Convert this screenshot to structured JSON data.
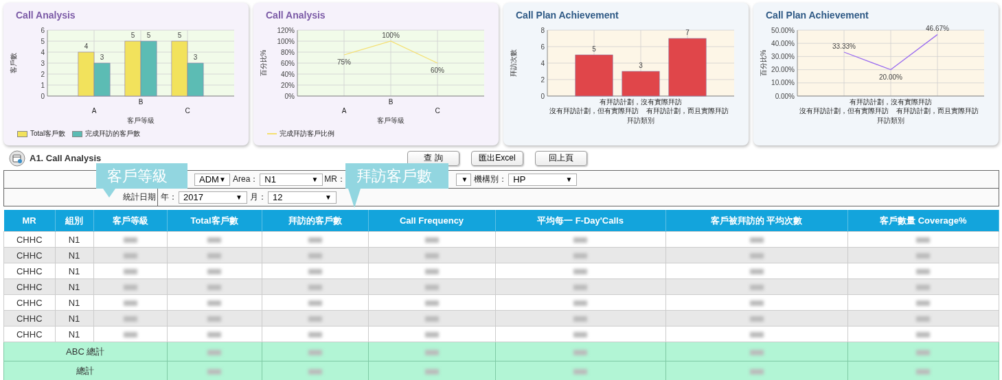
{
  "cards": [
    {
      "title": "Call Analysis",
      "chart_data": {
        "type": "bar",
        "grid": true,
        "xlabel": "客戶等級",
        "ylabel": "客戶數",
        "categories": [
          "A",
          "B",
          "C"
        ],
        "series": [
          {
            "name": "Total客戶數",
            "color": "#f2e25c",
            "values": [
              4,
              5,
              5
            ]
          },
          {
            "name": "完成拜訪的客戶數",
            "color": "#5cbcb4",
            "values": [
              3,
              5,
              3
            ]
          }
        ],
        "ylim": [
          0,
          6
        ],
        "yticks": [
          0,
          1,
          2,
          3,
          4,
          5,
          6
        ],
        "data_labels": true
      }
    },
    {
      "title": "Call Analysis",
      "chart_data": {
        "type": "line",
        "grid": true,
        "xlabel": "客戶等級",
        "ylabel": "百分比%",
        "categories": [
          "A",
          "B",
          "C"
        ],
        "series": [
          {
            "name": "完成拜訪客戶比例",
            "color": "#f5df70",
            "values": [
              75,
              100,
              60
            ]
          }
        ],
        "ylim": [
          0,
          120
        ],
        "yticks": [
          {
            "value": 0,
            "label": "0%"
          },
          {
            "value": 20,
            "label": "20%"
          },
          {
            "value": 40,
            "label": "40%"
          },
          {
            "value": 60,
            "label": "60%"
          },
          {
            "value": 80,
            "label": "80%"
          },
          {
            "value": 100,
            "label": "100%"
          },
          {
            "value": 120,
            "label": "120%"
          }
        ],
        "value_labels": [
          "75%",
          "100%",
          "60%"
        ]
      }
    },
    {
      "title": "Call Plan Achievement",
      "chart_data": {
        "type": "bar",
        "grid": true,
        "xlabel": "拜訪類別",
        "ylabel": "拜訪次數",
        "categories": [
          "沒有拜訪計劃，但有實際拜訪",
          "有拜訪計劃，沒有實際拜訪",
          "有拜訪計劃，而且實際拜訪"
        ],
        "series": [
          {
            "color": "#e0464a",
            "values": [
              5,
              3,
              7
            ]
          }
        ],
        "ylim": [
          0,
          8
        ],
        "yticks": [
          0,
          2,
          4,
          6,
          8
        ],
        "data_labels": true
      }
    },
    {
      "title": "Call Plan Achievement",
      "chart_data": {
        "type": "line",
        "grid": true,
        "xlabel": "拜訪類別",
        "ylabel": "百分比%",
        "categories": [
          "沒有拜訪計劃，但有實際拜訪",
          "有拜訪計劃，沒有實際拜訪",
          "有拜訪計劃，而且實際拜訪"
        ],
        "series": [
          {
            "color": "#9a6cf0",
            "values": [
              33.33,
              20,
              46.67
            ]
          }
        ],
        "ylim": [
          0,
          50
        ],
        "yticks": [
          {
            "value": 0,
            "label": "0.00%"
          },
          {
            "value": 10,
            "label": "10.00%"
          },
          {
            "value": 20,
            "label": "20.00%"
          },
          {
            "value": 30,
            "label": "30.00%"
          },
          {
            "value": 40,
            "label": "40.00%"
          },
          {
            "value": 50,
            "label": "50.00%"
          }
        ],
        "value_labels": [
          "33.33%",
          "20.00%",
          "46.67%"
        ]
      }
    }
  ],
  "section": {
    "title": "A1. Call Analysis",
    "buttons": [
      "查 詢",
      "匯出Excel",
      "回上頁"
    ]
  },
  "filters": [
    [
      {
        "value": "ADM",
        "caret": "▼"
      },
      {
        "label": "Area：",
        "value": "N1",
        "caret": "▼"
      },
      {
        "label": "MR：",
        "caret": "▼"
      },
      {
        "label": "機構別：",
        "value": "HP",
        "caret": "▼"
      }
    ],
    [
      {
        "label": "統計日期"
      },
      {
        "label": "年：",
        "value": "2017",
        "caret": "▼"
      },
      {
        "label": "月：",
        "value": "12",
        "caret": "▼"
      }
    ]
  ],
  "callouts": [
    {
      "text": "客戶等級"
    },
    {
      "text": "拜訪客戶數"
    }
  ],
  "table": {
    "columns": [
      "MR",
      "組別",
      "客戶等級",
      "Total客戶數",
      "拜訪的客戶數",
      "Call Frequency",
      "平均每一 F-Day'Calls",
      "客戶被拜訪的 平均次數",
      "客戶數量 Coverage%"
    ],
    "rows": [
      {
        "cells": [
          "CHHC",
          "N1"
        ]
      },
      {
        "cells": [
          "CHHC",
          "N1"
        ]
      },
      {
        "cells": [
          "CHHC",
          "N1"
        ]
      },
      {
        "cells": [
          "CHHC",
          "N1"
        ]
      },
      {
        "cells": [
          "CHHC",
          "N1"
        ]
      },
      {
        "cells": [
          "CHHC",
          "N1"
        ]
      },
      {
        "cells": [
          "CHHC",
          "N1"
        ]
      }
    ],
    "totals": [
      {
        "label": "ABC 總計"
      },
      {
        "label": "總計"
      }
    ]
  }
}
